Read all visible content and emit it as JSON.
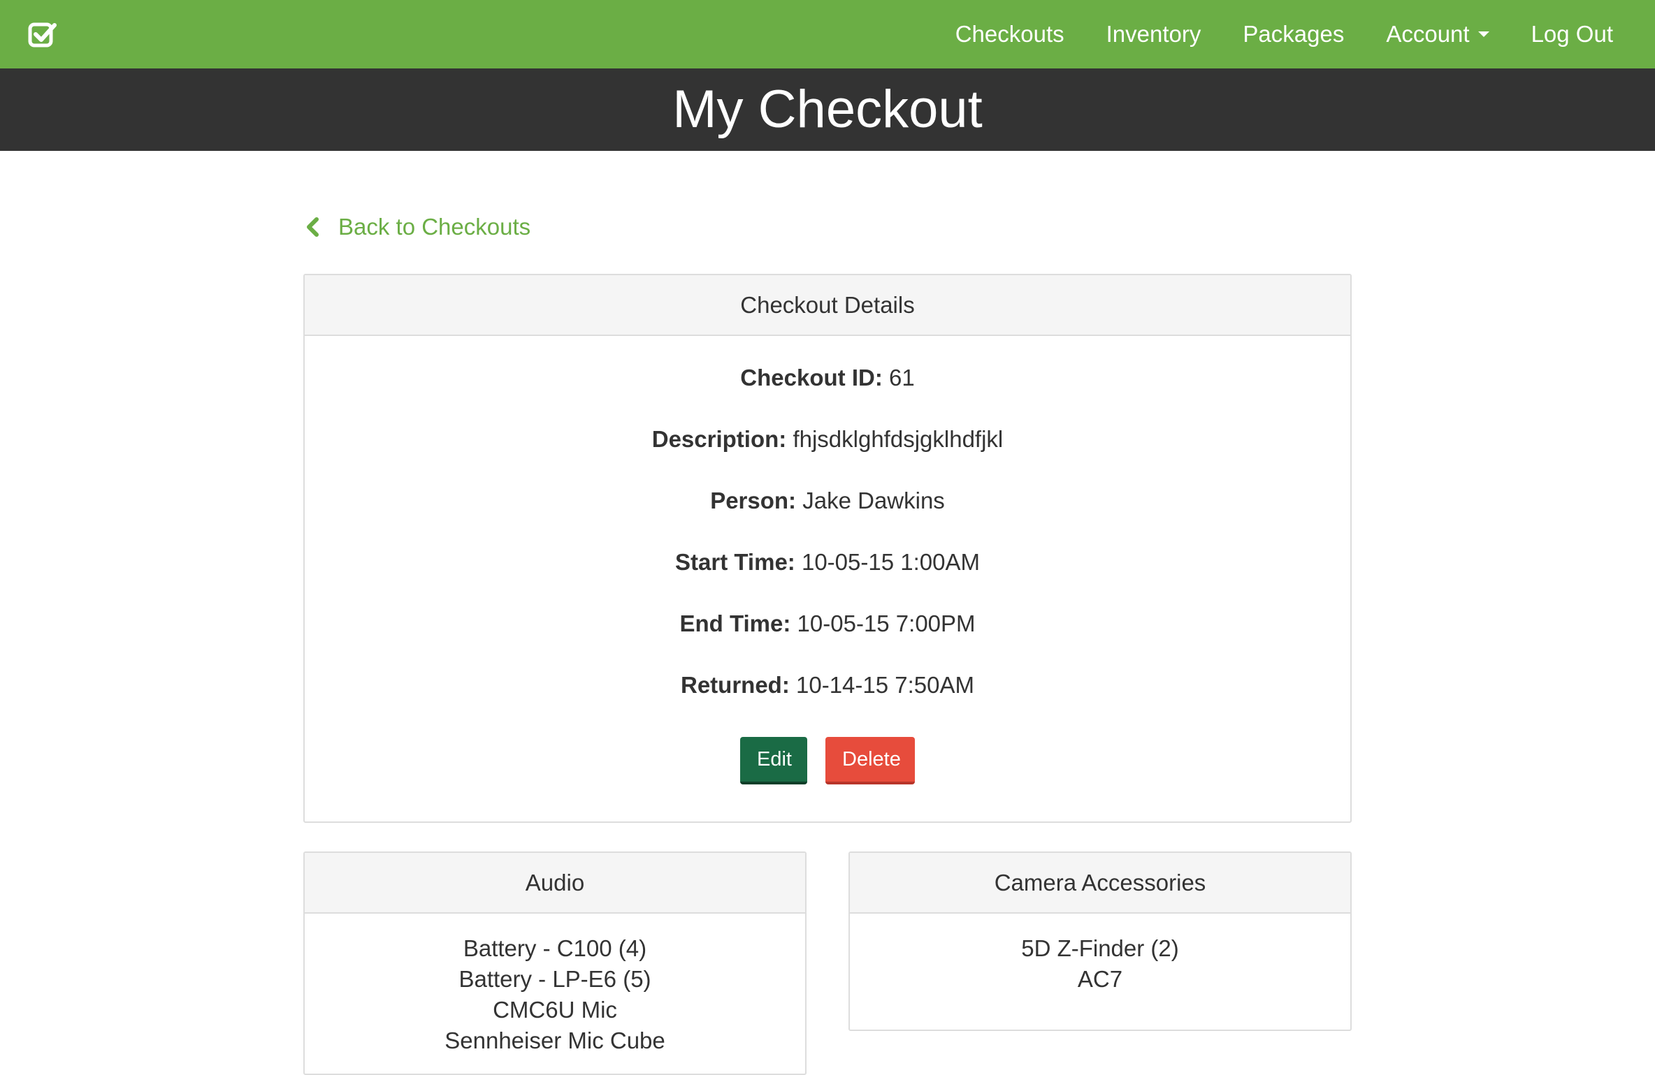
{
  "nav": {
    "brand_icon": "checkbox-check-icon",
    "links": [
      "Checkouts",
      "Inventory",
      "Packages",
      "Account",
      "Log Out"
    ]
  },
  "page_title": "My Checkout",
  "back_link": "Back to Checkouts",
  "details": {
    "heading": "Checkout Details",
    "fields": [
      {
        "label": "Checkout ID:",
        "value": "61"
      },
      {
        "label": "Description:",
        "value": "fhjsdklghfdsjgklhdfjkl"
      },
      {
        "label": "Person:",
        "value": "Jake Dawkins"
      },
      {
        "label": "Start Time:",
        "value": "10-05-15 1:00AM"
      },
      {
        "label": "End Time:",
        "value": "10-05-15 7:00PM"
      },
      {
        "label": "Returned:",
        "value": "10-14-15 7:50AM"
      }
    ],
    "edit_label": "Edit",
    "delete_label": "Delete"
  },
  "audio": {
    "heading": "Audio",
    "items": [
      "Battery - C100 (4)",
      "Battery - LP-E6 (5)",
      "CMC6U Mic",
      "Sennheiser Mic Cube"
    ]
  },
  "camera": {
    "heading": "Camera Accessories",
    "items": [
      "5D Z-Finder (2)",
      "AC7"
    ]
  },
  "colors": {
    "navbar": "#6bae45",
    "title_band": "#333333",
    "edit_button": "#1a6b45",
    "delete_button": "#e74c3c"
  }
}
